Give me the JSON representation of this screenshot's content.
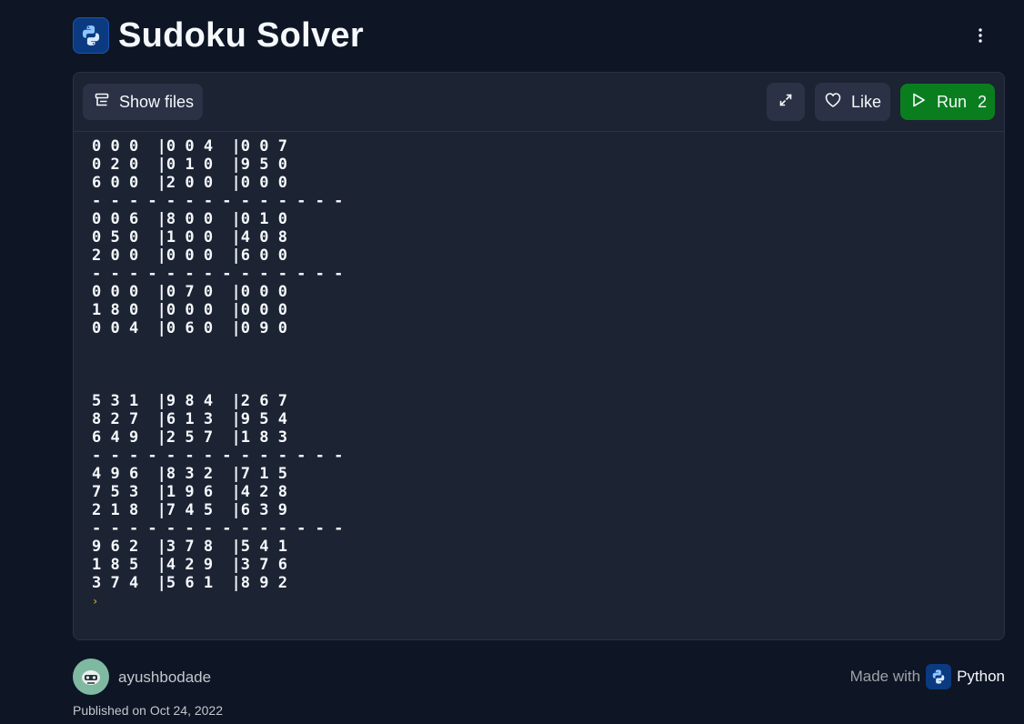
{
  "header": {
    "title": "Sudoku Solver",
    "logo_icon": "python-logo-icon",
    "menu_icon": "kebab-menu-icon"
  },
  "toolbar": {
    "show_files_label": "Show files",
    "like_label": "Like",
    "run_label": "Run",
    "run_count": "2"
  },
  "console": {
    "lines": [
      "0 0 0  |0 0 4  |0 0 7",
      "0 2 0  |0 1 0  |9 5 0",
      "6 0 0  |2 0 0  |0 0 0",
      "- - - - - - - - - - - - - -",
      "0 0 6  |8 0 0  |0 1 0",
      "0 5 0  |1 0 0  |4 0 8",
      "2 0 0  |0 0 0  |6 0 0",
      "- - - - - - - - - - - - - -",
      "0 0 0  |0 7 0  |0 0 0",
      "1 8 0  |0 0 0  |0 0 0",
      "0 0 4  |0 6 0  |0 9 0",
      "",
      "",
      "",
      "5 3 1  |9 8 4  |2 6 7",
      "8 2 7  |6 1 3  |9 5 4",
      "6 4 9  |2 5 7  |1 8 3",
      "- - - - - - - - - - - - - -",
      "4 9 6  |8 3 2  |7 1 5",
      "7 5 3  |1 9 6  |4 2 8",
      "2 1 8  |7 4 5  |6 3 9",
      "- - - - - - - - - - - - - -",
      "9 6 2  |3 7 8  |5 4 1",
      "1 8 5  |4 2 9  |3 7 6",
      "3 7 4  |5 6 1  |8 9 2"
    ],
    "prompt": "›"
  },
  "footer": {
    "author": "ayushbodade",
    "made_with": "Made with",
    "language": "Python",
    "published": "Published on Oct 24, 2022"
  },
  "colors": {
    "background": "#0e1525",
    "panel": "#1c2333",
    "button": "#2b3245",
    "run_button": "#0a7e1f",
    "prompt": "#c9a227"
  }
}
